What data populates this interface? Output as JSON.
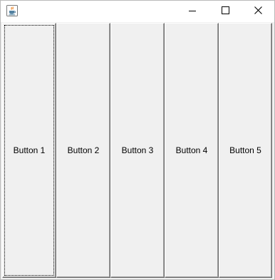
{
  "window": {
    "title": "",
    "icon": "java-coffee-cup-icon",
    "controls": {
      "minimize": "minimize-icon",
      "maximize": "maximize-icon",
      "close": "close-icon"
    }
  },
  "buttons": [
    {
      "label": "Button 1",
      "focused": true
    },
    {
      "label": "Button 2",
      "focused": false
    },
    {
      "label": "Button 3",
      "focused": false
    },
    {
      "label": "Button 4",
      "focused": false
    },
    {
      "label": "Button 5",
      "focused": false
    }
  ],
  "colors": {
    "window_background": "#f0f0f0",
    "titlebar_background": "#ffffff",
    "button_shadow": "#696969"
  }
}
